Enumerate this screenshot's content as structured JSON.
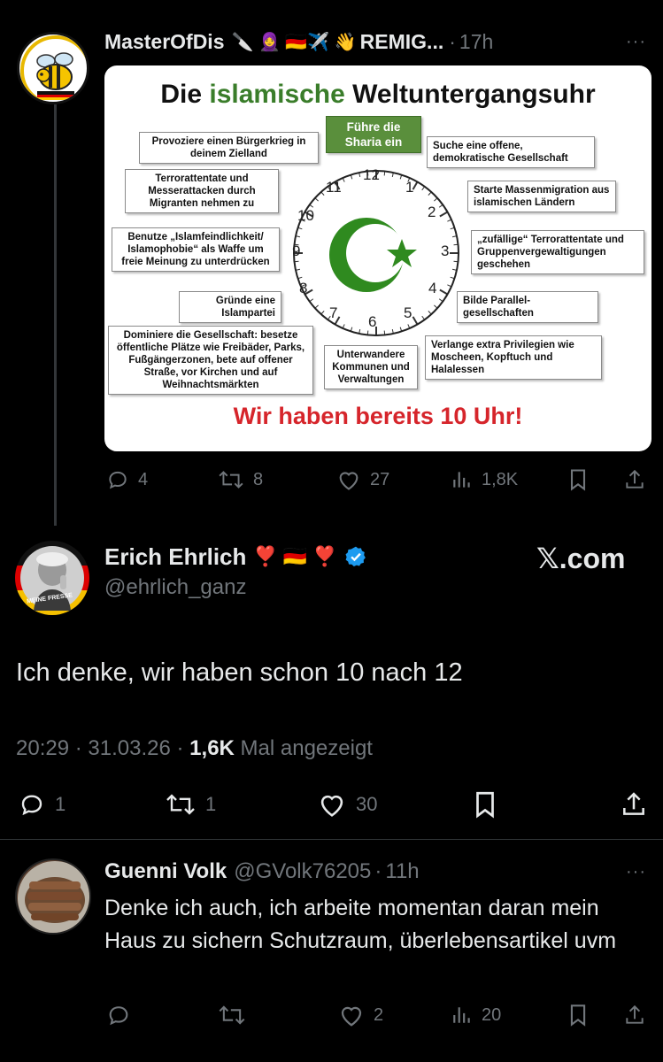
{
  "post1": {
    "author_name": "MasterOfDis",
    "author_emojis": "🔪 🧕 🇩🇪✈️ 👋",
    "author_suffix": "REMIG...",
    "dot": "·",
    "time": "17h",
    "more": "···",
    "image": {
      "title_pre": "Die ",
      "title_green": "islamische",
      "title_post": " Weltuntergangsuhr",
      "sharia": "Führe die Sharia ein",
      "boxes": {
        "civil_war": "Provoziere einen Bürgerkrieg in deinem Zielland",
        "terror_migrants": "Terrorattentate und Messerattacken durch Migranten nehmen zu",
        "islamophobia": "Benutze „Islamfeindlichkeit/ Islamophobie“ als Waffe um freie Meinung zu unterdrücken",
        "party": "Gründe eine Islampartei",
        "dominate": "Dominiere die Gesellschaft: besetze öffentliche Plätze wie Freibäder, Parks, Fußgängerzonen, bete auf offener Straße, vor Kirchen und auf Weihnachtsmärkten",
        "infiltrate": "Unterwandere Kommunen und Verwaltungen",
        "privileges": "Verlange extra Privilegien wie Moscheen, Kopftuch und Halalessen",
        "parallel": "Bilde Parallel-gesellschaften",
        "random_terror": "„zufällige“ Terrorattentate und Gruppenvergewaltigungen geschehen",
        "mass_migration": "Starte Massenmigration aus islamischen Ländern",
        "open_society": "Suche eine offene, demokratische Gesellschaft"
      },
      "clock_numbers": [
        "12",
        "1",
        "2",
        "3",
        "4",
        "5",
        "6",
        "7",
        "8",
        "9",
        "10",
        "11"
      ],
      "footer": "Wir haben bereits 10 Uhr!"
    },
    "actions": {
      "replies": "4",
      "reposts": "8",
      "likes": "27",
      "views": "1,8K"
    }
  },
  "main_post": {
    "author_name": "Erich Ehrlich",
    "author_emojis": "❣️ 🇩🇪 ❣️",
    "handle": "@ehrlich_ganz",
    "source_logo": "𝕏.com",
    "avatar_text": "MEINE FRESSE",
    "text": "Ich denke, wir haben schon 10 nach 12",
    "time": "20:29",
    "dot1": "·",
    "date": "31.03.26",
    "dot2": "·",
    "views_count": "1,6K",
    "views_label": "Mal angezeigt",
    "actions": {
      "replies": "1",
      "reposts": "1",
      "likes": "30"
    }
  },
  "reply": {
    "author_name": "Guenni Volk",
    "handle": "@GVolk76205",
    "dot": "·",
    "time": "11h",
    "more": "···",
    "text": "Denke ich auch, ich arbeite momentan daran mein Haus zu sichern  Schutzraum, überlebensartikel uvm",
    "actions": {
      "likes": "2",
      "views": "20"
    }
  },
  "colors": {
    "background": "#000000",
    "text": "#e7e9ea",
    "muted": "#71767b",
    "verified": "#1d9bf0",
    "green": "#3a7d2a",
    "red": "#d6252b"
  }
}
